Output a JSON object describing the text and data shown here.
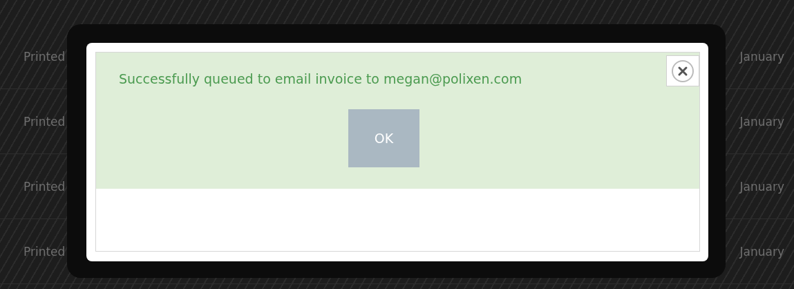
{
  "background_rows": [
    {
      "column_1": "Printed",
      "column_2": "January"
    },
    {
      "column_1": "Printed",
      "column_2": "January"
    },
    {
      "column_1": "Printed",
      "column_2": "January"
    },
    {
      "column_1": "Printed",
      "column_2": "January"
    }
  ],
  "dialog": {
    "message": "Successfully queued to email invoice to megan@polixen.com",
    "ok_button": "OK"
  }
}
